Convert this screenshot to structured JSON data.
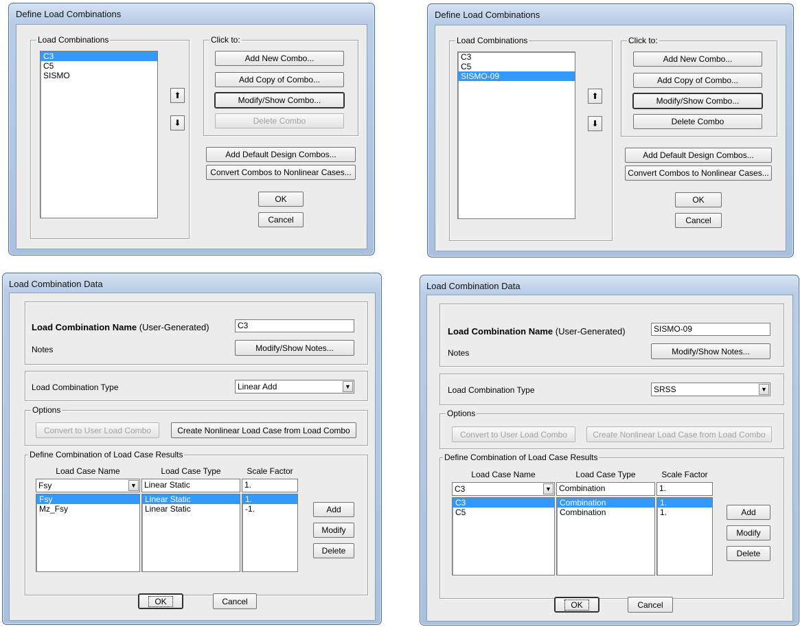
{
  "dlg_tl": {
    "title": "Define Load Combinations",
    "group_combos": "Load Combinations",
    "group_click": "Click to:",
    "items": [
      "C3",
      "C5",
      "SISMO"
    ],
    "btn_add_new": "Add New Combo...",
    "btn_add_copy": "Add Copy of Combo...",
    "btn_modify": "Modify/Show Combo...",
    "btn_delete": "Delete Combo",
    "btn_default": "Add Default Design Combos...",
    "btn_convert": "Convert Combos to Nonlinear Cases...",
    "btn_ok": "OK",
    "btn_cancel": "Cancel",
    "up_icon": "⬆",
    "down_icon": "⬇"
  },
  "dlg_tr": {
    "title": "Define Load Combinations",
    "group_combos": "Load Combinations",
    "group_click": "Click to:",
    "items": [
      "C3",
      "C5",
      "SISMO-09"
    ],
    "btn_add_new": "Add New Combo...",
    "btn_add_copy": "Add Copy of Combo...",
    "btn_modify": "Modify/Show Combo...",
    "btn_delete": "Delete Combo",
    "btn_default": "Add Default Design Combos...",
    "btn_convert": "Convert Combos to Nonlinear Cases...",
    "btn_ok": "OK",
    "btn_cancel": "Cancel",
    "up_icon": "⬆",
    "down_icon": "⬇"
  },
  "dlg_bl": {
    "title": "Load Combination Data",
    "name_label_bold": "Load Combination Name",
    "name_label_suffix": " (User-Generated)",
    "name_value": "C3",
    "notes_label": "Notes",
    "btn_notes": "Modify/Show Notes...",
    "type_label": "Load Combination Type",
    "type_value": "Linear Add",
    "options_label": "Options",
    "btn_convert_user": "Convert to User Load Combo",
    "btn_create_nl": "Create Nonlinear Load Case from Load Combo",
    "define_label": "Define Combination of Load Case Results",
    "col_name": "Load Case Name",
    "col_type": "Load Case Type",
    "col_scale": "Scale Factor",
    "edit_name": "Fsy",
    "edit_type": "Linear Static",
    "edit_scale": "1.",
    "rows": [
      {
        "name": "Fsy",
        "type": "Linear Static",
        "scale": "1."
      },
      {
        "name": "Mz_Fsy",
        "type": "Linear Static",
        "scale": "-1."
      }
    ],
    "btn_add": "Add",
    "btn_modify": "Modify",
    "btn_delete": "Delete",
    "btn_ok": "OK",
    "btn_cancel": "Cancel"
  },
  "dlg_br": {
    "title": "Load Combination Data",
    "name_label_bold": "Load Combination Name",
    "name_label_suffix": " (User-Generated)",
    "name_value": "SISMO-09",
    "notes_label": "Notes",
    "btn_notes": "Modify/Show Notes...",
    "type_label": "Load Combination Type",
    "type_value": "SRSS",
    "options_label": "Options",
    "btn_convert_user": "Convert to User Load Combo",
    "btn_create_nl": "Create Nonlinear Load Case from Load Combo",
    "define_label": "Define Combination of Load Case Results",
    "col_name": "Load Case Name",
    "col_type": "Load Case Type",
    "col_scale": "Scale Factor",
    "edit_name": "C3",
    "edit_type": "Combination",
    "edit_scale": "1.",
    "rows": [
      {
        "name": "C3",
        "type": "Combination",
        "scale": "1."
      },
      {
        "name": "C5",
        "type": "Combination",
        "scale": "1."
      }
    ],
    "btn_add": "Add",
    "btn_modify": "Modify",
    "btn_delete": "Delete",
    "btn_ok": "OK",
    "btn_cancel": "Cancel"
  },
  "colors": {
    "selection": "#3399ff",
    "dialog_bg": "#ececec"
  }
}
